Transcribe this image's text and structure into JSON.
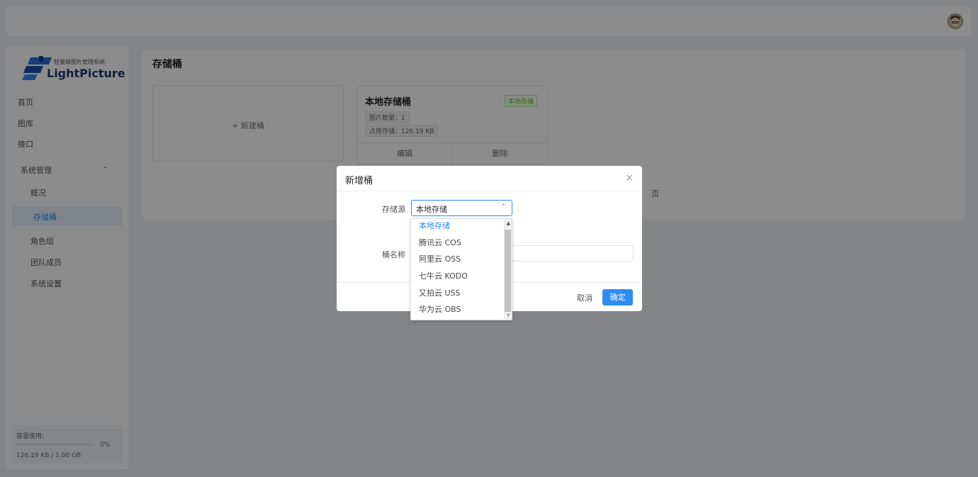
{
  "app": {
    "logo_subtitle": "轻量级图片管理系统",
    "logo_name": "LightPicture"
  },
  "sidebar": {
    "items": [
      {
        "label": "首页"
      },
      {
        "label": "图库"
      },
      {
        "label": "接口"
      }
    ],
    "group": {
      "label": "系统管理",
      "items": [
        {
          "label": "概况"
        },
        {
          "label": "存储桶"
        },
        {
          "label": "角色组"
        },
        {
          "label": "团队成员"
        },
        {
          "label": "系统设置"
        }
      ]
    },
    "usage": {
      "title": "容量使用:",
      "percent_text": "0%",
      "percent": 0,
      "value": "126.19 KB / 1.00 GB"
    }
  },
  "main": {
    "title": "存储桶",
    "new_card_label": "+ 新建桶",
    "bucket": {
      "name": "本地存储桶",
      "tag": "本地存储",
      "image_count": "图片数量：1",
      "storage_used": "占用存储：126.19 KB",
      "edit_label": "编辑",
      "delete_label": "删除"
    },
    "pager_fragment": "页"
  },
  "dialog": {
    "title": "新增桶",
    "close_glyph": "×",
    "source_label": "存储源",
    "source_value": "本地存储",
    "name_label": "桶名称",
    "name_value": "",
    "cancel_label": "取消",
    "ok_label": "确定",
    "options": [
      "本地存储",
      "腾讯云 COS",
      "阿里云 OSS",
      "七牛云 KODO",
      "又拍云 USS",
      "华为云 OBS"
    ]
  },
  "colors": {
    "accent": "#2d8cf0",
    "tag_green": "#52c41a"
  }
}
